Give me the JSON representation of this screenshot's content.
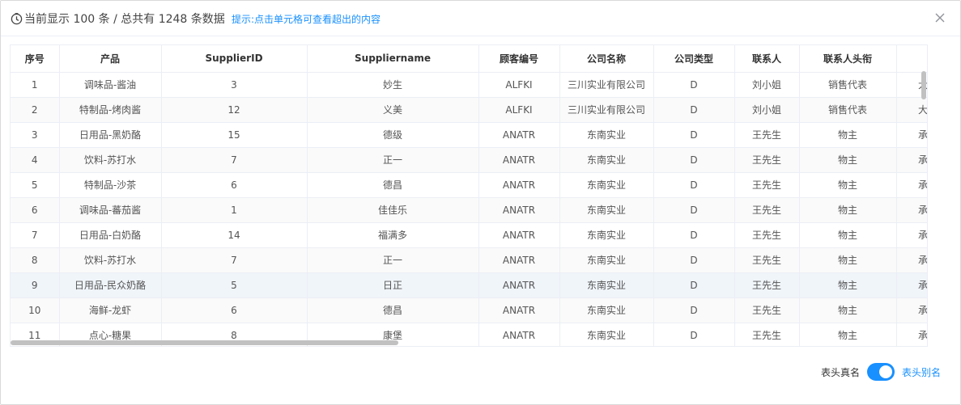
{
  "header": {
    "title": "当前显示 100 条 / 总共有 1248 条数据",
    "tip": "提示:点击单元格可查看超出的内容"
  },
  "table": {
    "columns": [
      "序号",
      "产品",
      "SupplierID",
      "Suppliername",
      "顾客编号",
      "公司名称",
      "公司类型",
      "联系人",
      "联系人头衔",
      ""
    ],
    "rows": [
      [
        "1",
        "调味品-酱油",
        "3",
        "妙生",
        "ALFKI",
        "三川实业有限公司",
        "D",
        "刘小姐",
        "销售代表",
        "大"
      ],
      [
        "2",
        "特制品-烤肉酱",
        "12",
        "义美",
        "ALFKI",
        "三川实业有限公司",
        "D",
        "刘小姐",
        "销售代表",
        "大"
      ],
      [
        "3",
        "日用品-黑奶酪",
        "15",
        "德级",
        "ANATR",
        "东南实业",
        "D",
        "王先生",
        "物主",
        "承"
      ],
      [
        "4",
        "饮料-苏打水",
        "7",
        "正一",
        "ANATR",
        "东南实业",
        "D",
        "王先生",
        "物主",
        "承"
      ],
      [
        "5",
        "特制品-沙茶",
        "6",
        "德昌",
        "ANATR",
        "东南实业",
        "D",
        "王先生",
        "物主",
        "承"
      ],
      [
        "6",
        "调味品-蕃茄酱",
        "1",
        "佳佳乐",
        "ANATR",
        "东南实业",
        "D",
        "王先生",
        "物主",
        "承"
      ],
      [
        "7",
        "日用品-白奶酪",
        "14",
        "福满多",
        "ANATR",
        "东南实业",
        "D",
        "王先生",
        "物主",
        "承"
      ],
      [
        "8",
        "饮料-苏打水",
        "7",
        "正一",
        "ANATR",
        "东南实业",
        "D",
        "王先生",
        "物主",
        "承"
      ],
      [
        "9",
        "日用品-民众奶酪",
        "5",
        "日正",
        "ANATR",
        "东南实业",
        "D",
        "王先生",
        "物主",
        "承"
      ],
      [
        "10",
        "海鲜-龙虾",
        "6",
        "德昌",
        "ANATR",
        "东南实业",
        "D",
        "王先生",
        "物主",
        "承"
      ],
      [
        "11",
        "点心-糖果",
        "8",
        "康堡",
        "ANATR",
        "东南实业",
        "D",
        "王先生",
        "物主",
        "承"
      ]
    ]
  },
  "footer": {
    "label_left": "表头真名",
    "label_right": "表头别名",
    "switch_on": true
  },
  "colors": {
    "accent": "#1890ff",
    "border": "#ebeef5"
  },
  "icons": {
    "clock": "clock-icon",
    "close": "close-icon"
  }
}
